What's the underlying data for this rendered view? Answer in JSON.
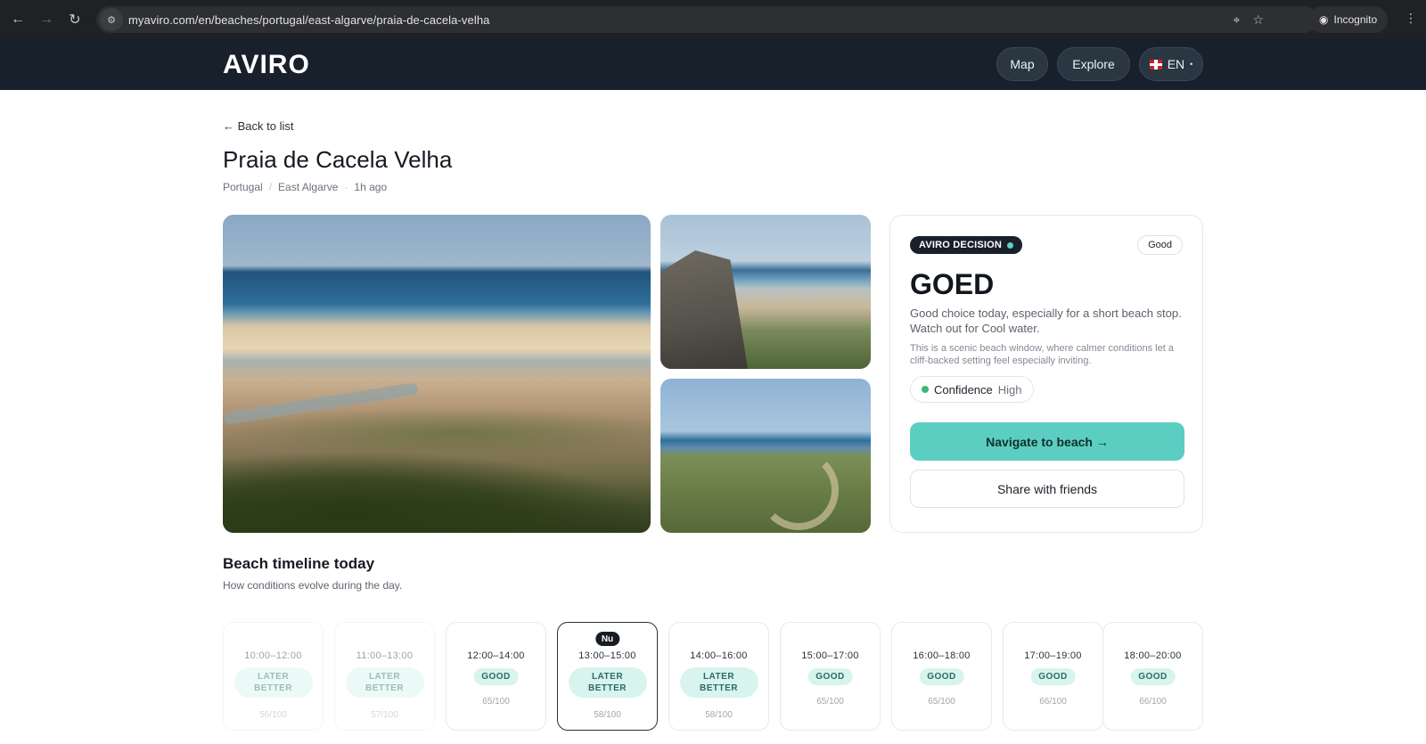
{
  "browser": {
    "url": "myaviro.com/en/beaches/portugal/east-algarve/praia-de-cacela-velha",
    "incognito_label": "Incognito"
  },
  "header": {
    "logo": "AVIRO",
    "map_label": "Map",
    "explore_label": "Explore",
    "lang_label": "EN"
  },
  "page": {
    "back_label": "← Back to list",
    "title": "Praia de Cacela Velha",
    "crumbs": [
      "Portugal",
      "East Algarve",
      "1h ago"
    ]
  },
  "decision": {
    "badge": "AVIRO DECISION",
    "rating_pill": "Good",
    "verdict": "GOED",
    "description": "Good choice today, especially for a short beach stop. Watch out for Cool water.",
    "subtext": "This is a scenic beach window, where calmer conditions let a cliff-backed setting feel especially inviting.",
    "confidence_label": "Confidence",
    "confidence_value": "High",
    "navigate_label": "Navigate to beach →",
    "share_label": "Share with friends"
  },
  "timeline": {
    "title": "Beach timeline today",
    "subtitle": "How conditions evolve during the day.",
    "now_badge": "Nu",
    "slots": [
      {
        "time": "10:00–12:00",
        "status_line1": "LATER",
        "status_line2": "BETTER",
        "score": "56/100"
      },
      {
        "time": "11:00–13:00",
        "status_line1": "LATER",
        "status_line2": "BETTER",
        "score": "57/100"
      },
      {
        "time": "12:00–14:00",
        "status_line1": "GOOD",
        "status_line2": "",
        "score": "65/100"
      },
      {
        "time": "13:00–15:00",
        "status_line1": "LATER",
        "status_line2": "BETTER",
        "score": "58/100"
      },
      {
        "time": "14:00–16:00",
        "status_line1": "LATER",
        "status_line2": "BETTER",
        "score": "58/100"
      },
      {
        "time": "15:00–17:00",
        "status_line1": "GOOD",
        "status_line2": "",
        "score": "65/100"
      },
      {
        "time": "16:00–18:00",
        "status_line1": "GOOD",
        "status_line2": "",
        "score": "65/100"
      },
      {
        "time": "17:00–19:00",
        "status_line1": "GOOD",
        "status_line2": "",
        "score": "66/100"
      },
      {
        "time": "18:00–20:00",
        "status_line1": "GOOD",
        "status_line2": "",
        "score": "66/100"
      }
    ]
  },
  "colors": {
    "brand_dark": "#17202b",
    "accent_teal": "#5ccdc1",
    "confidence_green": "#3bb877"
  }
}
